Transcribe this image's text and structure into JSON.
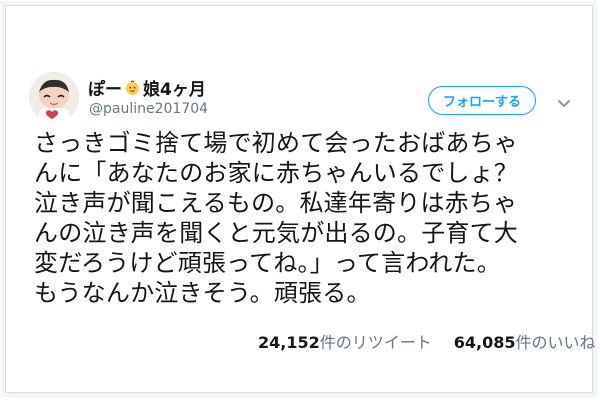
{
  "user": {
    "display_name": "ぽー",
    "display_name_suffix": "娘4ヶ月",
    "handle": "@pauline201704",
    "avatar_icon": "baby-avatar"
  },
  "actions": {
    "follow_label": "フォローする",
    "menu_icon": "chevron-down-icon"
  },
  "tweet": {
    "text": "さっきゴミ捨て場で初めて会ったおばあちゃ\nんに「あなたのお家に赤ちゃんいるでしょ？\n泣き声が聞こえるもの。私達年寄りは赤ちゃ\nんの泣き声を聞くと元気が出るの。子育て大\n変だろうけど頑張ってね。」って言われた。\nもうなんか泣きそう。頑張る。"
  },
  "stats": {
    "retweets_count": "24,152",
    "retweets_label": "件のリツイート",
    "likes_count": "64,085",
    "likes_label": "件のいいね"
  },
  "colors": {
    "accent": "#1da1f2",
    "text": "#14171a",
    "muted": "#657786"
  }
}
